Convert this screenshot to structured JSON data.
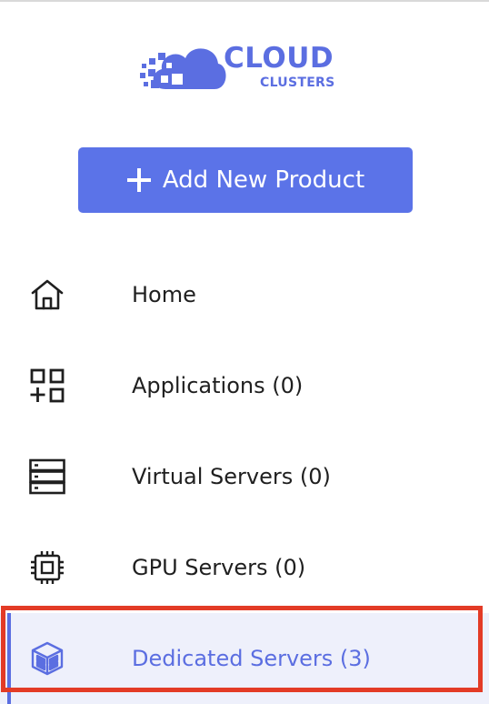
{
  "brand": {
    "line1": "CLOUD",
    "line2": "CLUSTERS",
    "color": "#5b6ee1"
  },
  "add_button": {
    "label": "Add New Product",
    "icon": "plus-icon",
    "color": "#5b73e8"
  },
  "nav": {
    "items": [
      {
        "label": "Home",
        "icon": "home-icon",
        "active": false
      },
      {
        "label": "Applications (0)",
        "icon": "applications-grid-icon",
        "active": false
      },
      {
        "label": "Virtual Servers (0)",
        "icon": "server-rack-icon",
        "active": false
      },
      {
        "label": "GPU Servers (0)",
        "icon": "cpu-chip-icon",
        "active": false
      },
      {
        "label": "Dedicated Servers (3)",
        "icon": "dedicated-server-cube-icon",
        "active": true
      }
    ]
  },
  "colors": {
    "active_bg": "#eef0fb",
    "active_text": "#5b6ee1",
    "highlight": "#e33b26"
  }
}
